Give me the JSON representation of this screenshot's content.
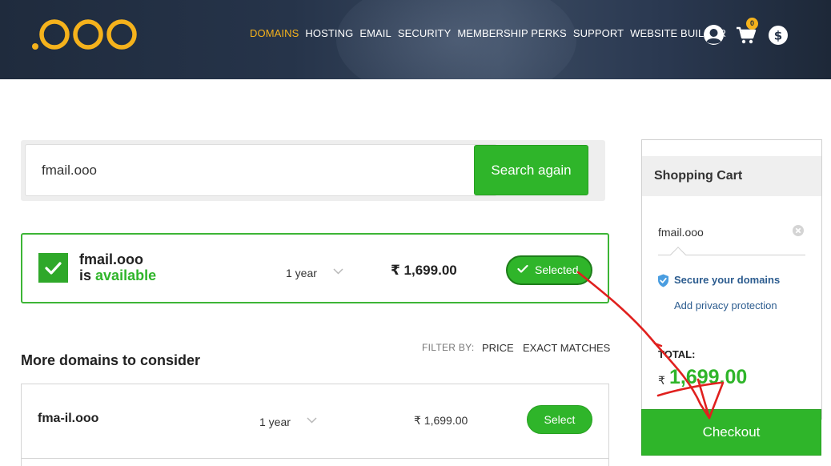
{
  "header": {
    "nav": [
      {
        "label": "DOMAINS",
        "active": true
      },
      {
        "label": "HOSTING"
      },
      {
        "label": "EMAIL"
      },
      {
        "label": "SECURITY"
      },
      {
        "label": "MEMBERSHIP PERKS"
      },
      {
        "label": "SUPPORT"
      },
      {
        "label": "WEBSITE BUILDER"
      }
    ],
    "cart_count": "0",
    "icons": [
      "user-icon",
      "cart-icon",
      "currency-icon"
    ]
  },
  "search": {
    "value": "fmail.ooo",
    "button": "Search again"
  },
  "result": {
    "domain": "fmail.ooo",
    "is_text": "is",
    "available_text": "available",
    "term": "1 year",
    "price": "₹ 1,699.00",
    "button": "Selected"
  },
  "more": {
    "title": "More domains to consider",
    "filter_label": "FILTER BY:",
    "filter_price": "PRICE",
    "filter_exact": "EXACT MATCHES",
    "items": [
      {
        "domain": "fma-il.ooo",
        "term": "1 year",
        "price": "₹ 1,699.00",
        "button": "Select"
      }
    ]
  },
  "cart": {
    "title": "Shopping Cart",
    "item": "fmail.ooo",
    "secure": "Secure your domains",
    "privacy": "Add privacy protection",
    "total_label": "TOTAL:",
    "currency": "₹",
    "total": "1,699.00",
    "checkout": "Checkout"
  },
  "colors": {
    "accent_green": "#2fb52a",
    "nav_active": "#f5b21c",
    "header_bg": "#1f2b3d",
    "link_blue": "#2c5c8f",
    "annotation_red": "#e0201e"
  }
}
